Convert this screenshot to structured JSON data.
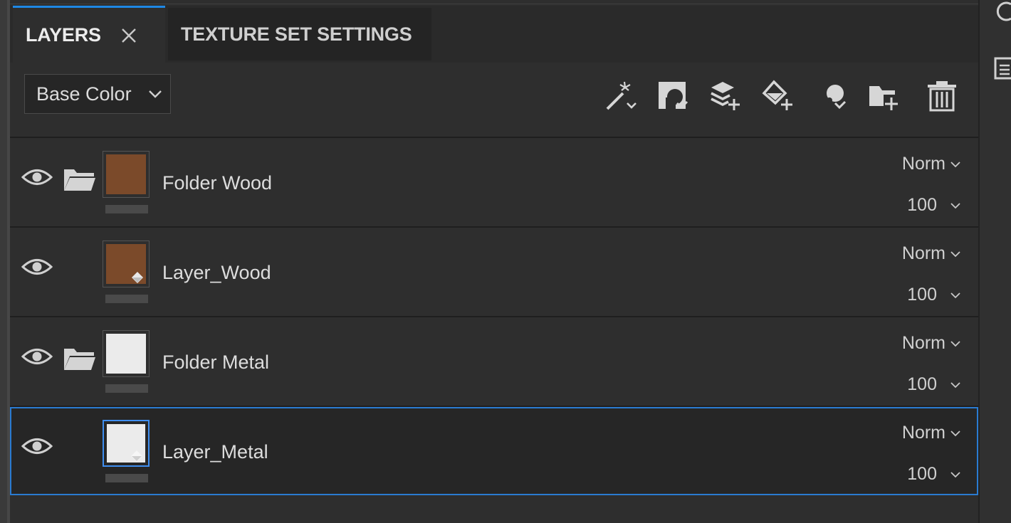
{
  "tabs": {
    "layers_label": "LAYERS",
    "texture_set_label": "TEXTURE SET SETTINGS"
  },
  "channel_dropdown": {
    "value": "Base Color"
  },
  "toolbar": {
    "icons": [
      "magic-wand-icon",
      "add-mask-icon",
      "add-layer-icon",
      "add-fill-layer-icon",
      "add-effect-icon",
      "add-folder-icon",
      "delete-icon"
    ]
  },
  "layers": [
    {
      "name": "Folder Wood",
      "type": "folder",
      "blend": "Norm",
      "opacity": "100",
      "thumb_color": "#7b4a2a",
      "selected": false
    },
    {
      "name": "Layer_Wood",
      "type": "fill",
      "blend": "Norm",
      "opacity": "100",
      "thumb_color": "#7b4a2a",
      "selected": false
    },
    {
      "name": "Folder Metal",
      "type": "folder",
      "blend": "Norm",
      "opacity": "100",
      "thumb_color": "#ebebeb",
      "selected": false
    },
    {
      "name": "Layer_Metal",
      "type": "fill",
      "blend": "Norm",
      "opacity": "100",
      "thumb_color": "#ebebeb",
      "selected": true
    }
  ],
  "colors": {
    "accent": "#2a7bd1",
    "panel_bg": "#2e2e2e",
    "wood": "#7b4a2a",
    "metal": "#ebebeb"
  }
}
